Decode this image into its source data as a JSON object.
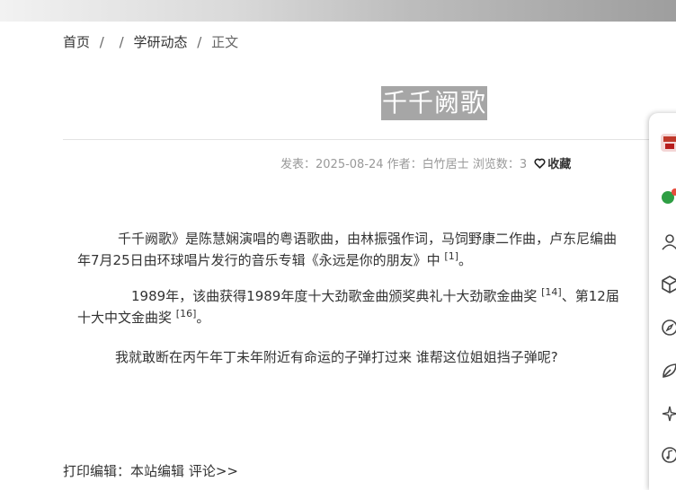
{
  "breadcrumb": {
    "home": "首页",
    "sep1": "/",
    "sep2": "/",
    "section": "学研动态",
    "sep3": "/",
    "current": "正文"
  },
  "article": {
    "title": "千千阙歌",
    "meta_text": "发表：2025-08-24 作者：白竹居士 浏览数：3",
    "favorite_label": "收藏",
    "paragraphs": {
      "p1_line1": "千千阙歌》是陈慧娴演唱的粤语歌曲，由林振强作词，马饲野康二作曲，卢东尼编曲",
      "p1_line2": "年7月25日由环球唱片发行的音乐专辑《永远是你的朋友》中",
      "p1_ref": "[1]",
      "p1_end": "。",
      "p2_line1": "1989年，该曲获得1989年度十大劲歌金曲颁奖典礼十大劲歌金曲奖",
      "p2_ref1": "[14]",
      "p2_line1b": "、第12届",
      "p2_line2": "十大中文金曲奖",
      "p2_ref2": "[16]",
      "p2_end": "。",
      "p3": "我就敢断在丙午年丁未年附近有命运的子弹打过来   谁帮这位姐姐挡子弹呢?"
    }
  },
  "footer": {
    "print_label": "打印",
    "editor_label": "编辑：本站编辑",
    "comment_link": "评论>>"
  },
  "side_panel": {
    "icons": [
      "app-logo-icon",
      "chat-icon",
      "user-icon",
      "cube-icon",
      "compass-icon",
      "leaf-icon",
      "sparkle-icon",
      "music-icon"
    ]
  },
  "colors": {
    "title_highlight": "#a6a6a6",
    "meta_text": "#999999",
    "body_text": "#333333"
  }
}
